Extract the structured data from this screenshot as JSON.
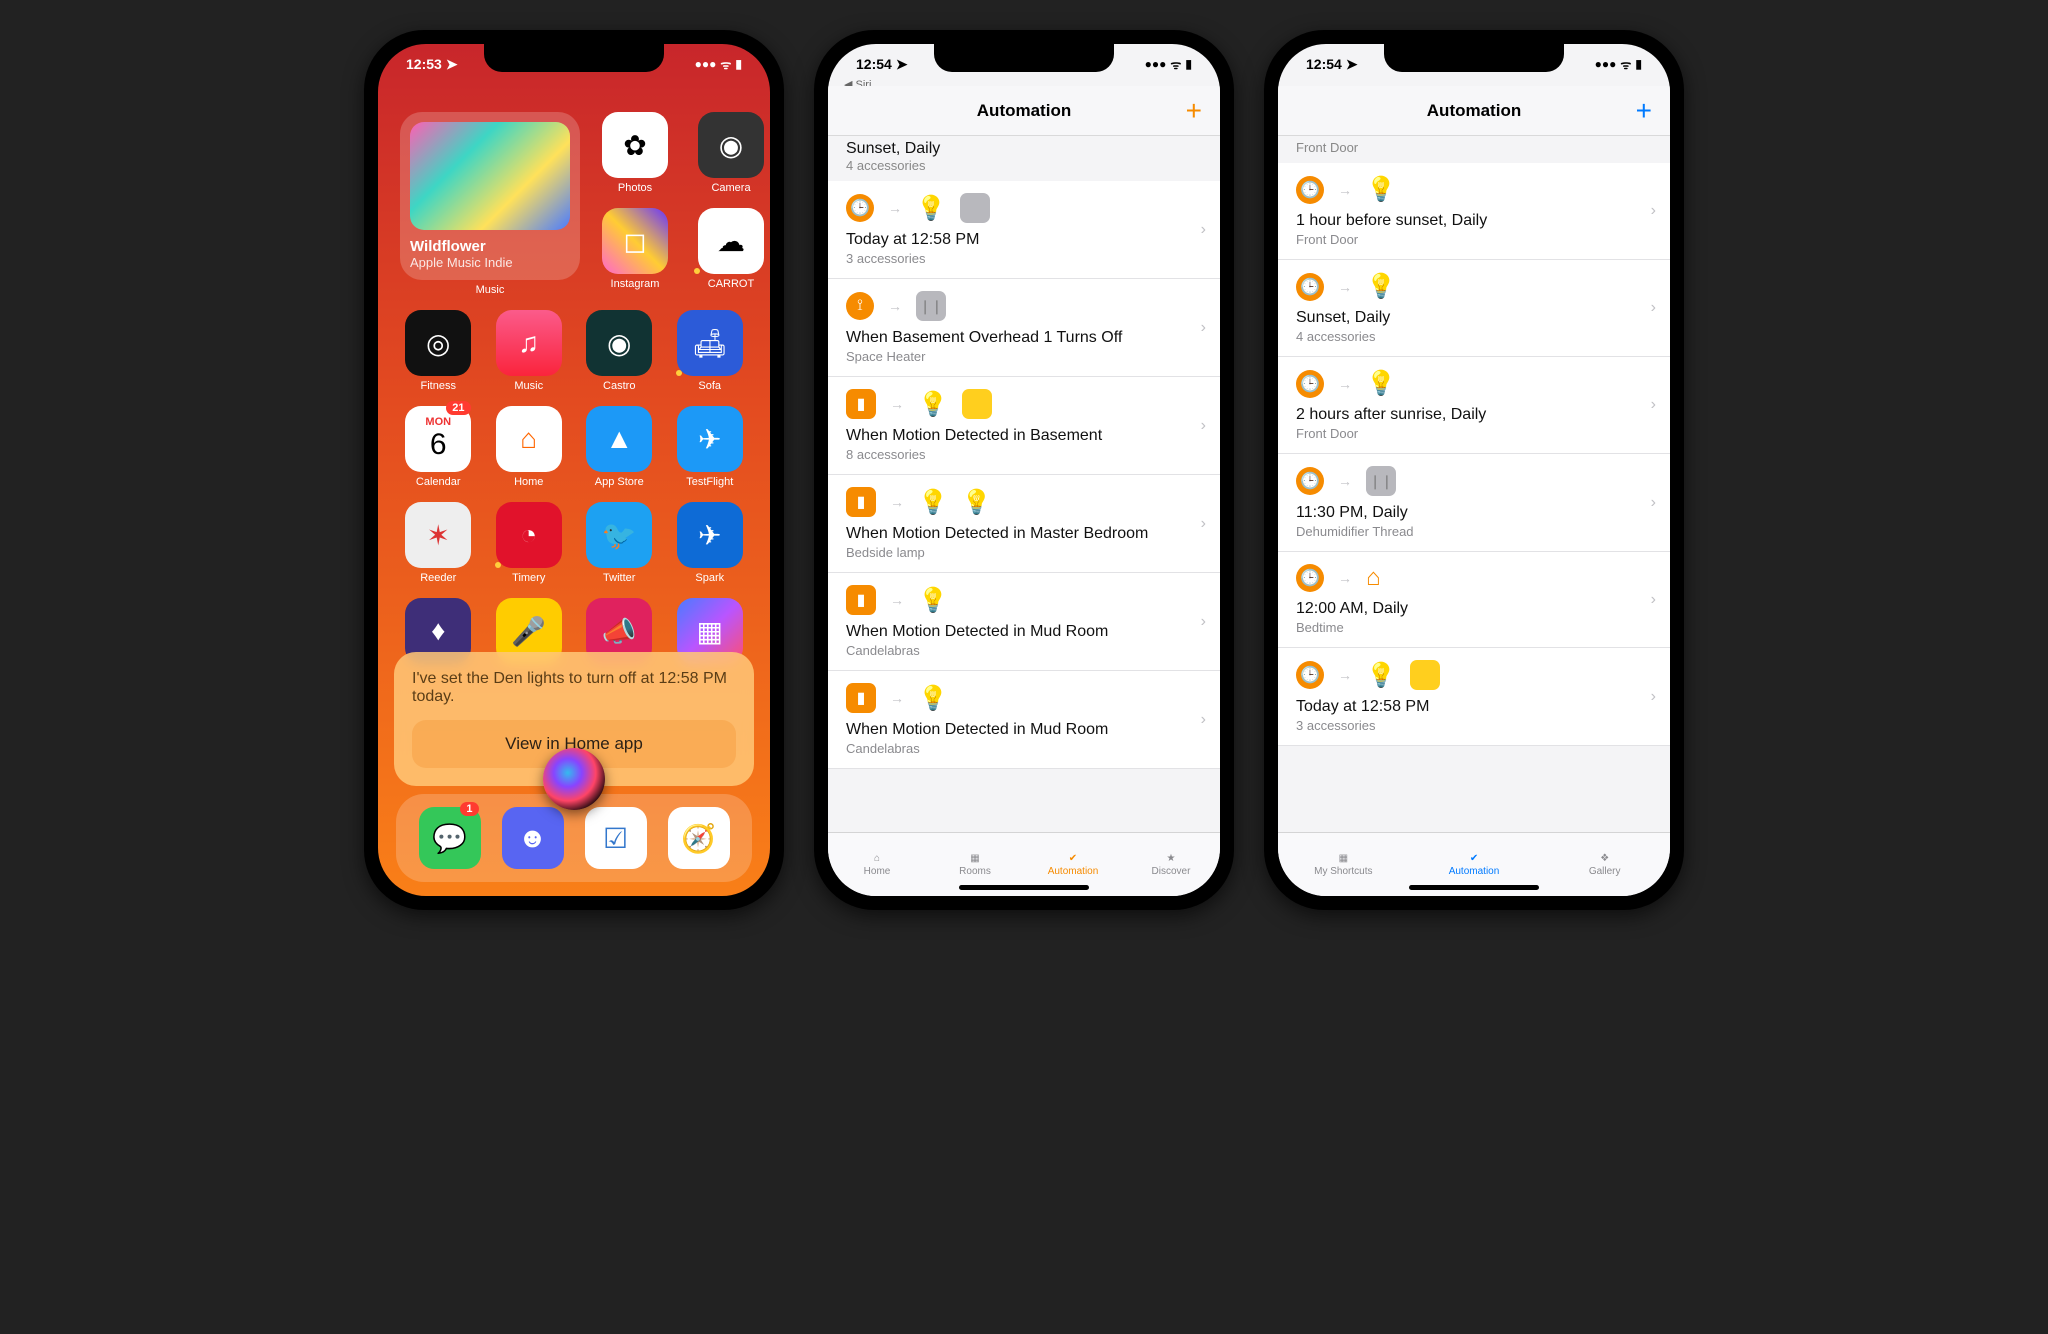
{
  "phone1": {
    "time": "12:53",
    "music_widget": {
      "title": "Wildflower",
      "subtitle": "Apple Music Indie",
      "label": "Music"
    },
    "apps": {
      "photos": "Photos",
      "camera": "Camera",
      "instagram": "Instagram",
      "carrot": "CARROT",
      "fitness": "Fitness",
      "music": "Music",
      "castro": "Castro",
      "sofa": "Sofa",
      "calendar": "Calendar",
      "calendar_day": "6",
      "calendar_dow": "MON",
      "calendar_badge": "21",
      "home": "Home",
      "appstore": "App Store",
      "testflight": "TestFlight",
      "reeder": "Reeder",
      "timery": "Timery",
      "twitter": "Twitter",
      "spark": "Spark",
      "messages_badge": "1"
    },
    "siri": {
      "message": "I've set the Den lights to turn off at 12:58 PM today.",
      "button": "View in Home app"
    }
  },
  "phone2": {
    "time": "12:54",
    "back": "◀ Siri",
    "title": "Automation",
    "plus_color": "#f68b00",
    "peek_title": "Sunset, Daily",
    "peek_sub": "4 accessories",
    "rows": [
      {
        "title": "Today at 12:58 PM",
        "sub": "3 accessories",
        "trigger": "time",
        "targets": [
          "bulb-off",
          "lamp-off"
        ]
      },
      {
        "title": "When Basement Overhead 1 Turns Off",
        "sub": "Space Heater",
        "trigger": "arrive",
        "targets": [
          "plug-off"
        ]
      },
      {
        "title": "When Motion Detected in Basement",
        "sub": "8 accessories",
        "trigger": "sensor",
        "targets": [
          "bulb",
          "lamp"
        ]
      },
      {
        "title": "When Motion Detected in Master Bedroom",
        "sub": "Bedside lamp",
        "trigger": "sensor",
        "targets": [
          "bulb",
          "bulb-off"
        ]
      },
      {
        "title": "When Motion Detected in Mud Room",
        "sub": "Candelabras",
        "trigger": "sensor",
        "targets": [
          "bulb"
        ]
      },
      {
        "title": "When Motion Detected in Mud Room",
        "sub": "Candelabras",
        "trigger": "sensor",
        "targets": [
          "bulb"
        ]
      }
    ],
    "tabs": [
      "Home",
      "Rooms",
      "Automation",
      "Discover"
    ]
  },
  "phone3": {
    "time": "12:54",
    "title": "Automation",
    "plus_color": "#007aff",
    "peek": "Front Door",
    "rows": [
      {
        "title": "1 hour before sunset, Daily",
        "sub": "Front Door",
        "trigger": "time",
        "targets": [
          "bulb"
        ]
      },
      {
        "title": "Sunset, Daily",
        "sub": "4 accessories",
        "trigger": "time",
        "targets": [
          "bulb"
        ]
      },
      {
        "title": "2 hours after sunrise, Daily",
        "sub": "Front Door",
        "trigger": "time",
        "targets": [
          "bulb"
        ]
      },
      {
        "title": "11:30 PM, Daily",
        "sub": "Dehumidifier Thread",
        "trigger": "time",
        "targets": [
          "plug-off"
        ]
      },
      {
        "title": "12:00 AM, Daily",
        "sub": "Bedtime",
        "trigger": "time",
        "targets": [
          "home"
        ]
      },
      {
        "title": "Today at 12:58 PM",
        "sub": "3 accessories",
        "trigger": "time",
        "targets": [
          "bulb",
          "lamp"
        ]
      }
    ],
    "tabs": [
      "My Shortcuts",
      "Automation",
      "Gallery"
    ]
  }
}
